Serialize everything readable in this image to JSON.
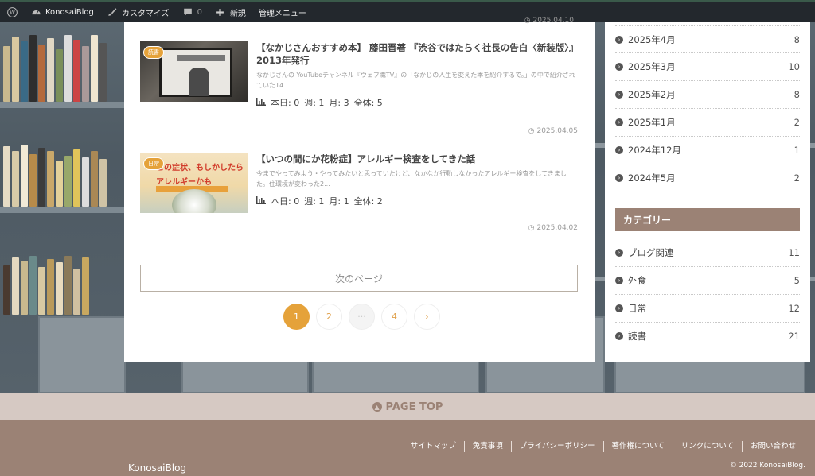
{
  "adminbar": {
    "site_name": "KonosaiBlog",
    "customize": "カスタマイズ",
    "comments_count": "0",
    "new": "新規",
    "manage_menu": "管理メニュー"
  },
  "posts": [
    {
      "top_date": "2025.04.10",
      "badge": "読書",
      "title": "【なかじさんおすすめ本】 藤田晋著 『渋谷ではたらく社長の告白〈新装版〉』2013年発行",
      "excerpt": "なかじさんの YouTubeチャンネル『ウェブ職TV』の「なかじの人生を変えた本を紹介するで。」の中で紹介されていた14...",
      "stats": {
        "today": "本日: 0",
        "week": "週: 1",
        "month": "月: 3",
        "total": "全体: 5"
      },
      "date": "2025.04.05"
    },
    {
      "badge": "日常",
      "thumb_text_1": "この症状、もしかしたら",
      "thumb_text_2": "アレルギーかも",
      "title": "【いつの間にか花粉症】アレルギー検査をしてきた話",
      "excerpt": "今までやってみよう・やってみたいと思っていたけど、なかなか行動しなかったアレルギー検査をしてきました。住環境が変わった2...",
      "stats": {
        "today": "本日: 0",
        "week": "週: 1",
        "month": "月: 1",
        "total": "全体: 2"
      },
      "date": "2025.04.02"
    }
  ],
  "next_page": "次のページ",
  "pagination": [
    "1",
    "2",
    "···",
    "4",
    "›"
  ],
  "archives": [
    {
      "label": "2025年4月",
      "count": "8"
    },
    {
      "label": "2025年3月",
      "count": "10"
    },
    {
      "label": "2025年2月",
      "count": "8"
    },
    {
      "label": "2025年1月",
      "count": "2"
    },
    {
      "label": "2024年12月",
      "count": "1"
    },
    {
      "label": "2024年5月",
      "count": "2"
    }
  ],
  "categories_title": "カテゴリー",
  "categories": [
    {
      "label": "ブログ関連",
      "count": "11"
    },
    {
      "label": "外食",
      "count": "5"
    },
    {
      "label": "日常",
      "count": "12"
    },
    {
      "label": "読書",
      "count": "21"
    }
  ],
  "page_top": "PAGE TOP",
  "footer": {
    "links": [
      "サイトマップ",
      "免責事項",
      "プライバシーポリシー",
      "著作権について",
      "リンクについて",
      "お問い合わせ"
    ],
    "logo": "KonosaiBlog",
    "copyright": "© 2022 KonosaiBlog."
  },
  "colors": {
    "accent": "#e5a23a",
    "brown": "#9b8275",
    "pagetop_bg": "#d6c9c3",
    "adminbar": "#23282d"
  },
  "icons": [
    "wordpress-icon",
    "dashboard-icon",
    "brush-icon",
    "comment-icon",
    "plus-icon",
    "chevron-right-circle-icon",
    "clock-icon",
    "bar-chart-icon",
    "chevron-up-circle-icon"
  ]
}
